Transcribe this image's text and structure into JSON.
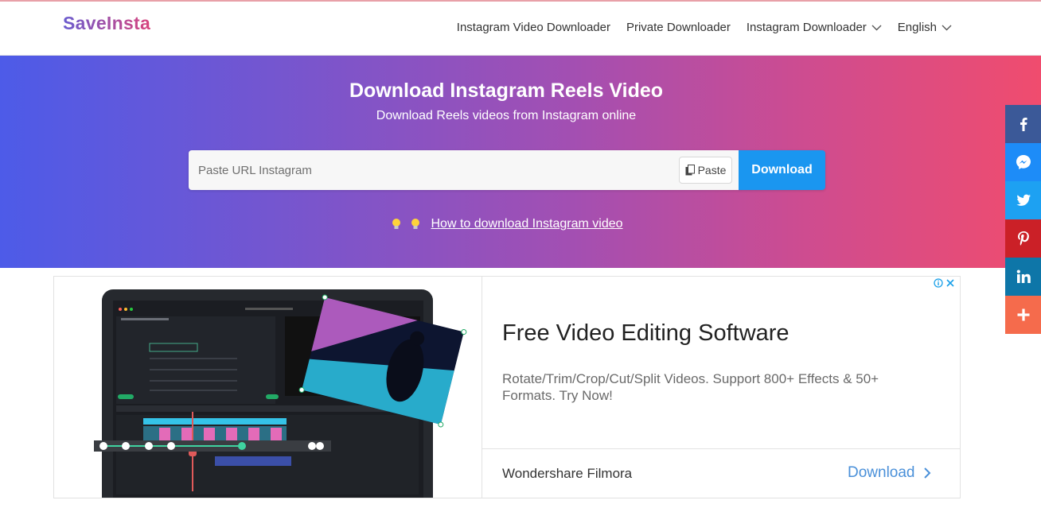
{
  "header": {
    "logo": "SaveInsta",
    "nav": [
      {
        "label": "Instagram Video Downloader",
        "dropdown": false
      },
      {
        "label": "Private Downloader",
        "dropdown": false
      },
      {
        "label": "Instagram Downloader",
        "dropdown": true
      },
      {
        "label": "English",
        "dropdown": true
      }
    ]
  },
  "hero": {
    "title": "Download Instagram Reels Video",
    "subtitle": "Download Reels videos from Instagram online",
    "search": {
      "placeholder": "Paste URL Instagram",
      "paste_label": "Paste",
      "download_label": "Download"
    },
    "howto_link": "How to download Instagram video",
    "gradient": [
      "#4d5be8",
      "#f04c6e"
    ]
  },
  "social": [
    {
      "name": "facebook-icon",
      "color": "#3b5998"
    },
    {
      "name": "messenger-icon",
      "color": "#1d8cf8"
    },
    {
      "name": "twitter-icon",
      "color": "#1da1f2"
    },
    {
      "name": "pinterest-icon",
      "color": "#cb2027"
    },
    {
      "name": "linkedin-icon",
      "color": "#0e76a8"
    },
    {
      "name": "more-share-icon",
      "color": "#f56b4c"
    }
  ],
  "ad": {
    "title": "Free Video Editing Software",
    "description": "Rotate/Trim/Crop/Cut/Split Videos. Support 800+ Effects & 50+ Formats. Try Now!",
    "brand": "Wondershare Filmora",
    "cta": "Download"
  }
}
